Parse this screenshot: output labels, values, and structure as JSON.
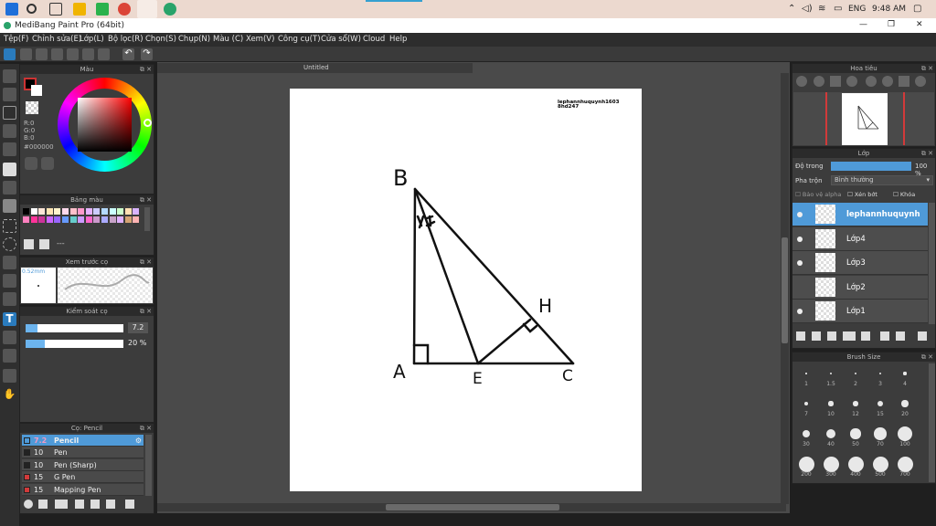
{
  "taskbar": {
    "clock": "9:48 AM",
    "language": "ENG"
  },
  "window": {
    "title": "MediBang Paint Pro (64bit)",
    "minimize": "—",
    "restore": "❐",
    "close": "✕"
  },
  "menu": [
    "Tệp(F)",
    "Chỉnh sửa(E)",
    "Lớp(L)",
    "Bộ lọc(R)",
    "Chọn(S)",
    "Chụp(N)",
    "Màu (C)",
    "Xem(V)",
    "Công cụ(T)",
    "Cửa sổ(W)",
    "Cloud",
    "Help"
  ],
  "color_panel": {
    "title": "Màu",
    "r": "R:0",
    "g": "G:0",
    "b": "B:0",
    "hex": "#000000"
  },
  "palette_panel": {
    "title": "Bảng màu",
    "dash": "---",
    "swatches": [
      "#000000",
      "#ffffff",
      "#fce4d6",
      "#ffe5b4",
      "#fff4cc",
      "#ffd9ec",
      "#ffc0cb",
      "#ff99cc",
      "#e6b3ff",
      "#ccccff",
      "#b3d9ff",
      "#ccffff",
      "#ccffcc",
      "#ffe0b3",
      "#d9b3ff",
      "#ff80bf",
      "#ff3399",
      "#cc3399",
      "#cc66ff",
      "#9966ff",
      "#6699ff",
      "#66cccc",
      "#cc99ff",
      "#ff66cc",
      "#cc99cc",
      "#aaaaff",
      "#c8a2c8",
      "#e0b0ff",
      "#d4a373",
      "#ffb3b3"
    ]
  },
  "preview_panel": {
    "title": "Xem trước cọ",
    "size": "0.52mm"
  },
  "brush_control": {
    "title": "Kiểm soát cọ",
    "size_value": "7.2",
    "opacity_value": "20 %",
    "size_fill": 0.12,
    "opacity_fill": 0.2
  },
  "brush_list": {
    "title": "Cọ: Pencil",
    "items": [
      {
        "size": "7.2",
        "name": "Pencil",
        "color": "#4f9ad8"
      },
      {
        "size": "10",
        "name": "Pen",
        "color": "#222222"
      },
      {
        "size": "10",
        "name": "Pen (Sharp)",
        "color": "#222222"
      },
      {
        "size": "15",
        "name": "G Pen",
        "color": "#d23a3a"
      },
      {
        "size": "15",
        "name": "Mapping Pen",
        "color": "#d23a3a"
      }
    ]
  },
  "document": {
    "tab": "Untitled",
    "signature": "lephannhuquynh1603",
    "signature2": "8hd247",
    "labels": {
      "B": "B",
      "A": "A",
      "E": "E",
      "C": "C",
      "H": "H"
    }
  },
  "navigator": {
    "title": "Hoa tiêu"
  },
  "layers": {
    "title": "Lớp",
    "opacity_label": "Độ trong",
    "opacity_value": "100 %",
    "blend_label": "Pha trộn",
    "blend_value": "Bình thường",
    "alpha_label": "Bảo vệ alpha",
    "clip_label": "Xén bớt",
    "lock_label": "Khóa",
    "items": [
      "lephannhuquynh",
      "Lớp4",
      "Lớp3",
      "Lớp2",
      "Lớp1"
    ]
  },
  "brush_size": {
    "title": "Brush Size",
    "sizes": [
      "1",
      "1.5",
      "2",
      "3",
      "4",
      "7",
      "10",
      "12",
      "15",
      "20",
      "30",
      "40",
      "50",
      "70",
      "100",
      "200",
      "300",
      "400",
      "500",
      "700"
    ]
  }
}
